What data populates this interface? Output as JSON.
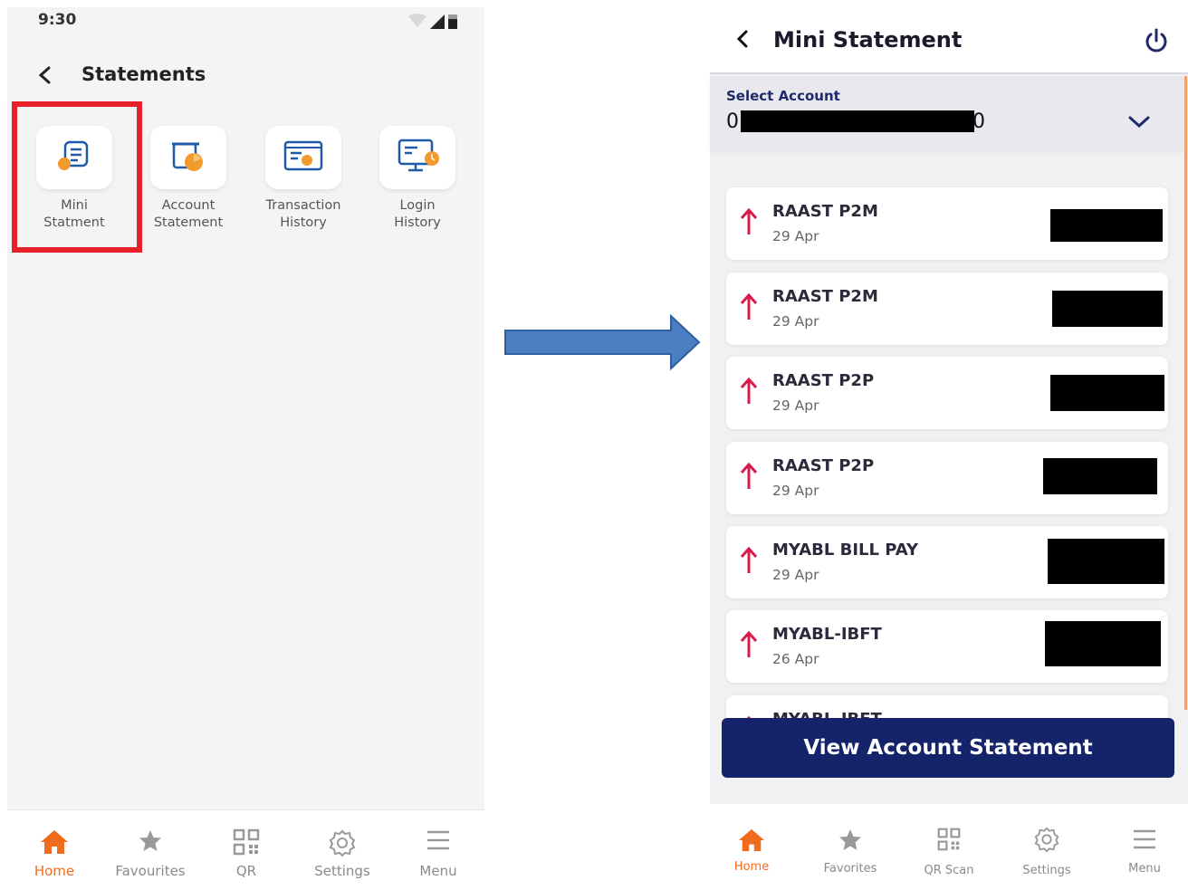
{
  "left_screen": {
    "status_time": "9:30",
    "title": "Statements",
    "tiles": [
      {
        "label": "Mini\nStatment",
        "icon": "mini-statement-icon"
      },
      {
        "label": "Account\nStatement",
        "icon": "account-statement-icon"
      },
      {
        "label": "Transaction\nHistory",
        "icon": "transaction-history-icon"
      },
      {
        "label": "Login\nHistory",
        "icon": "login-history-icon"
      }
    ],
    "nav": [
      {
        "label": "Home",
        "icon": "home-icon",
        "active": true
      },
      {
        "label": "Favourites",
        "icon": "star-icon",
        "active": false
      },
      {
        "label": "QR",
        "icon": "qr-icon",
        "active": false
      },
      {
        "label": "Settings",
        "icon": "gear-icon",
        "active": false
      },
      {
        "label": "Menu",
        "icon": "menu-icon",
        "active": false
      }
    ]
  },
  "right_screen": {
    "title": "Mini Statement",
    "select_account_label": "Select Account",
    "account_prefix": "0",
    "account_suffix": "0",
    "transactions": [
      {
        "title": "RAAST P2M",
        "date": "29 Apr"
      },
      {
        "title": "RAAST P2M",
        "date": "29 Apr"
      },
      {
        "title": "RAAST P2P",
        "date": "29 Apr"
      },
      {
        "title": "RAAST P2P",
        "date": "29 Apr"
      },
      {
        "title": "MYABL BILL PAY",
        "date": "29 Apr"
      },
      {
        "title": "MYABL-IBFT",
        "date": "26 Apr"
      },
      {
        "title": "MYABL-IBFT",
        "date": ""
      }
    ],
    "view_statement_label": "View Account Statement",
    "nav": [
      {
        "label": "Home",
        "icon": "home-icon",
        "active": true
      },
      {
        "label": "Favorites",
        "icon": "star-icon",
        "active": false
      },
      {
        "label": "QR Scan",
        "icon": "qr-icon",
        "active": false
      },
      {
        "label": "Settings",
        "icon": "gear-icon",
        "active": false
      },
      {
        "label": "Menu",
        "icon": "menu-icon",
        "active": false
      }
    ]
  },
  "colors": {
    "accent_orange": "#ef6c1f",
    "highlight_red": "#e8202a",
    "navy_button": "#15236a",
    "arrow_blue": "#4a7fc1",
    "debit_arrow": "#d81b4a"
  }
}
